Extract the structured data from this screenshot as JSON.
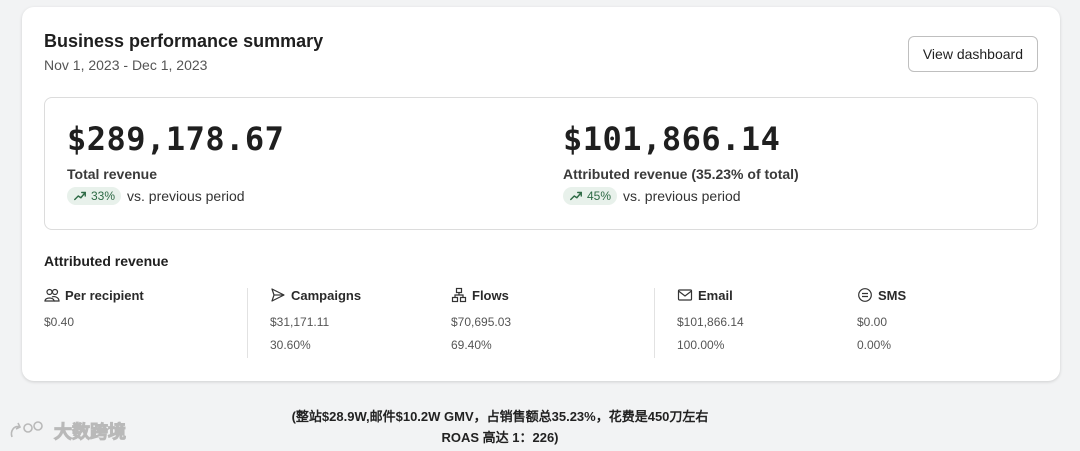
{
  "header": {
    "title": "Business performance summary",
    "date_range": "Nov 1, 2023 - Dec 1, 2023",
    "view_button": "View dashboard"
  },
  "kpis": [
    {
      "value": "$289,178.67",
      "label": "Total revenue",
      "delta": "33%",
      "delta_suffix": "vs. previous period"
    },
    {
      "value": "$101,866.14",
      "label": "Attributed revenue (35.23% of total)",
      "delta": "45%",
      "delta_suffix": "vs. previous period"
    }
  ],
  "attributed": {
    "title": "Attributed revenue",
    "metrics": [
      {
        "label": "Per recipient",
        "icon": "people-icon",
        "value": "$0.40",
        "percent": ""
      },
      {
        "label": "Campaigns",
        "icon": "send-icon",
        "value": "$31,171.11",
        "percent": "30.60%"
      },
      {
        "label": "Flows",
        "icon": "flow-icon",
        "value": "$70,695.03",
        "percent": "69.40%"
      },
      {
        "label": "Email",
        "icon": "mail-icon",
        "value": "$101,866.14",
        "percent": "100.00%"
      },
      {
        "label": "SMS",
        "icon": "sms-icon",
        "value": "$0.00",
        "percent": "0.00%"
      }
    ]
  },
  "caption": {
    "line1": "(整站$28.9W,邮件$10.2W GMV，占销售额总35.23%，花费是450刀左右",
    "line2": "ROAS 高达 1：226)"
  },
  "watermark": "大数跨境",
  "colors": {
    "accent_green": "#2d6a45",
    "pill_bg": "#e8f1eb"
  }
}
